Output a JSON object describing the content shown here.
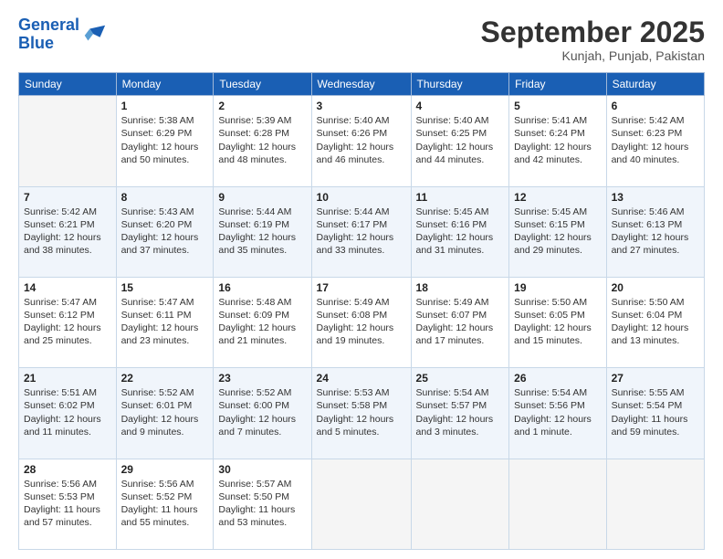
{
  "logo": {
    "line1": "General",
    "line2": "Blue"
  },
  "title": "September 2025",
  "location": "Kunjah, Punjab, Pakistan",
  "days_of_week": [
    "Sunday",
    "Monday",
    "Tuesday",
    "Wednesday",
    "Thursday",
    "Friday",
    "Saturday"
  ],
  "weeks": [
    [
      {
        "num": "",
        "empty": true
      },
      {
        "num": "1",
        "sunrise": "Sunrise: 5:38 AM",
        "sunset": "Sunset: 6:29 PM",
        "daylight": "Daylight: 12 hours and 50 minutes."
      },
      {
        "num": "2",
        "sunrise": "Sunrise: 5:39 AM",
        "sunset": "Sunset: 6:28 PM",
        "daylight": "Daylight: 12 hours and 48 minutes."
      },
      {
        "num": "3",
        "sunrise": "Sunrise: 5:40 AM",
        "sunset": "Sunset: 6:26 PM",
        "daylight": "Daylight: 12 hours and 46 minutes."
      },
      {
        "num": "4",
        "sunrise": "Sunrise: 5:40 AM",
        "sunset": "Sunset: 6:25 PM",
        "daylight": "Daylight: 12 hours and 44 minutes."
      },
      {
        "num": "5",
        "sunrise": "Sunrise: 5:41 AM",
        "sunset": "Sunset: 6:24 PM",
        "daylight": "Daylight: 12 hours and 42 minutes."
      },
      {
        "num": "6",
        "sunrise": "Sunrise: 5:42 AM",
        "sunset": "Sunset: 6:23 PM",
        "daylight": "Daylight: 12 hours and 40 minutes."
      }
    ],
    [
      {
        "num": "7",
        "sunrise": "Sunrise: 5:42 AM",
        "sunset": "Sunset: 6:21 PM",
        "daylight": "Daylight: 12 hours and 38 minutes."
      },
      {
        "num": "8",
        "sunrise": "Sunrise: 5:43 AM",
        "sunset": "Sunset: 6:20 PM",
        "daylight": "Daylight: 12 hours and 37 minutes."
      },
      {
        "num": "9",
        "sunrise": "Sunrise: 5:44 AM",
        "sunset": "Sunset: 6:19 PM",
        "daylight": "Daylight: 12 hours and 35 minutes."
      },
      {
        "num": "10",
        "sunrise": "Sunrise: 5:44 AM",
        "sunset": "Sunset: 6:17 PM",
        "daylight": "Daylight: 12 hours and 33 minutes."
      },
      {
        "num": "11",
        "sunrise": "Sunrise: 5:45 AM",
        "sunset": "Sunset: 6:16 PM",
        "daylight": "Daylight: 12 hours and 31 minutes."
      },
      {
        "num": "12",
        "sunrise": "Sunrise: 5:45 AM",
        "sunset": "Sunset: 6:15 PM",
        "daylight": "Daylight: 12 hours and 29 minutes."
      },
      {
        "num": "13",
        "sunrise": "Sunrise: 5:46 AM",
        "sunset": "Sunset: 6:13 PM",
        "daylight": "Daylight: 12 hours and 27 minutes."
      }
    ],
    [
      {
        "num": "14",
        "sunrise": "Sunrise: 5:47 AM",
        "sunset": "Sunset: 6:12 PM",
        "daylight": "Daylight: 12 hours and 25 minutes."
      },
      {
        "num": "15",
        "sunrise": "Sunrise: 5:47 AM",
        "sunset": "Sunset: 6:11 PM",
        "daylight": "Daylight: 12 hours and 23 minutes."
      },
      {
        "num": "16",
        "sunrise": "Sunrise: 5:48 AM",
        "sunset": "Sunset: 6:09 PM",
        "daylight": "Daylight: 12 hours and 21 minutes."
      },
      {
        "num": "17",
        "sunrise": "Sunrise: 5:49 AM",
        "sunset": "Sunset: 6:08 PM",
        "daylight": "Daylight: 12 hours and 19 minutes."
      },
      {
        "num": "18",
        "sunrise": "Sunrise: 5:49 AM",
        "sunset": "Sunset: 6:07 PM",
        "daylight": "Daylight: 12 hours and 17 minutes."
      },
      {
        "num": "19",
        "sunrise": "Sunrise: 5:50 AM",
        "sunset": "Sunset: 6:05 PM",
        "daylight": "Daylight: 12 hours and 15 minutes."
      },
      {
        "num": "20",
        "sunrise": "Sunrise: 5:50 AM",
        "sunset": "Sunset: 6:04 PM",
        "daylight": "Daylight: 12 hours and 13 minutes."
      }
    ],
    [
      {
        "num": "21",
        "sunrise": "Sunrise: 5:51 AM",
        "sunset": "Sunset: 6:02 PM",
        "daylight": "Daylight: 12 hours and 11 minutes."
      },
      {
        "num": "22",
        "sunrise": "Sunrise: 5:52 AM",
        "sunset": "Sunset: 6:01 PM",
        "daylight": "Daylight: 12 hours and 9 minutes."
      },
      {
        "num": "23",
        "sunrise": "Sunrise: 5:52 AM",
        "sunset": "Sunset: 6:00 PM",
        "daylight": "Daylight: 12 hours and 7 minutes."
      },
      {
        "num": "24",
        "sunrise": "Sunrise: 5:53 AM",
        "sunset": "Sunset: 5:58 PM",
        "daylight": "Daylight: 12 hours and 5 minutes."
      },
      {
        "num": "25",
        "sunrise": "Sunrise: 5:54 AM",
        "sunset": "Sunset: 5:57 PM",
        "daylight": "Daylight: 12 hours and 3 minutes."
      },
      {
        "num": "26",
        "sunrise": "Sunrise: 5:54 AM",
        "sunset": "Sunset: 5:56 PM",
        "daylight": "Daylight: 12 hours and 1 minute."
      },
      {
        "num": "27",
        "sunrise": "Sunrise: 5:55 AM",
        "sunset": "Sunset: 5:54 PM",
        "daylight": "Daylight: 11 hours and 59 minutes."
      }
    ],
    [
      {
        "num": "28",
        "sunrise": "Sunrise: 5:56 AM",
        "sunset": "Sunset: 5:53 PM",
        "daylight": "Daylight: 11 hours and 57 minutes."
      },
      {
        "num": "29",
        "sunrise": "Sunrise: 5:56 AM",
        "sunset": "Sunset: 5:52 PM",
        "daylight": "Daylight: 11 hours and 55 minutes."
      },
      {
        "num": "30",
        "sunrise": "Sunrise: 5:57 AM",
        "sunset": "Sunset: 5:50 PM",
        "daylight": "Daylight: 11 hours and 53 minutes."
      },
      {
        "num": "",
        "empty": true
      },
      {
        "num": "",
        "empty": true
      },
      {
        "num": "",
        "empty": true
      },
      {
        "num": "",
        "empty": true
      }
    ]
  ]
}
